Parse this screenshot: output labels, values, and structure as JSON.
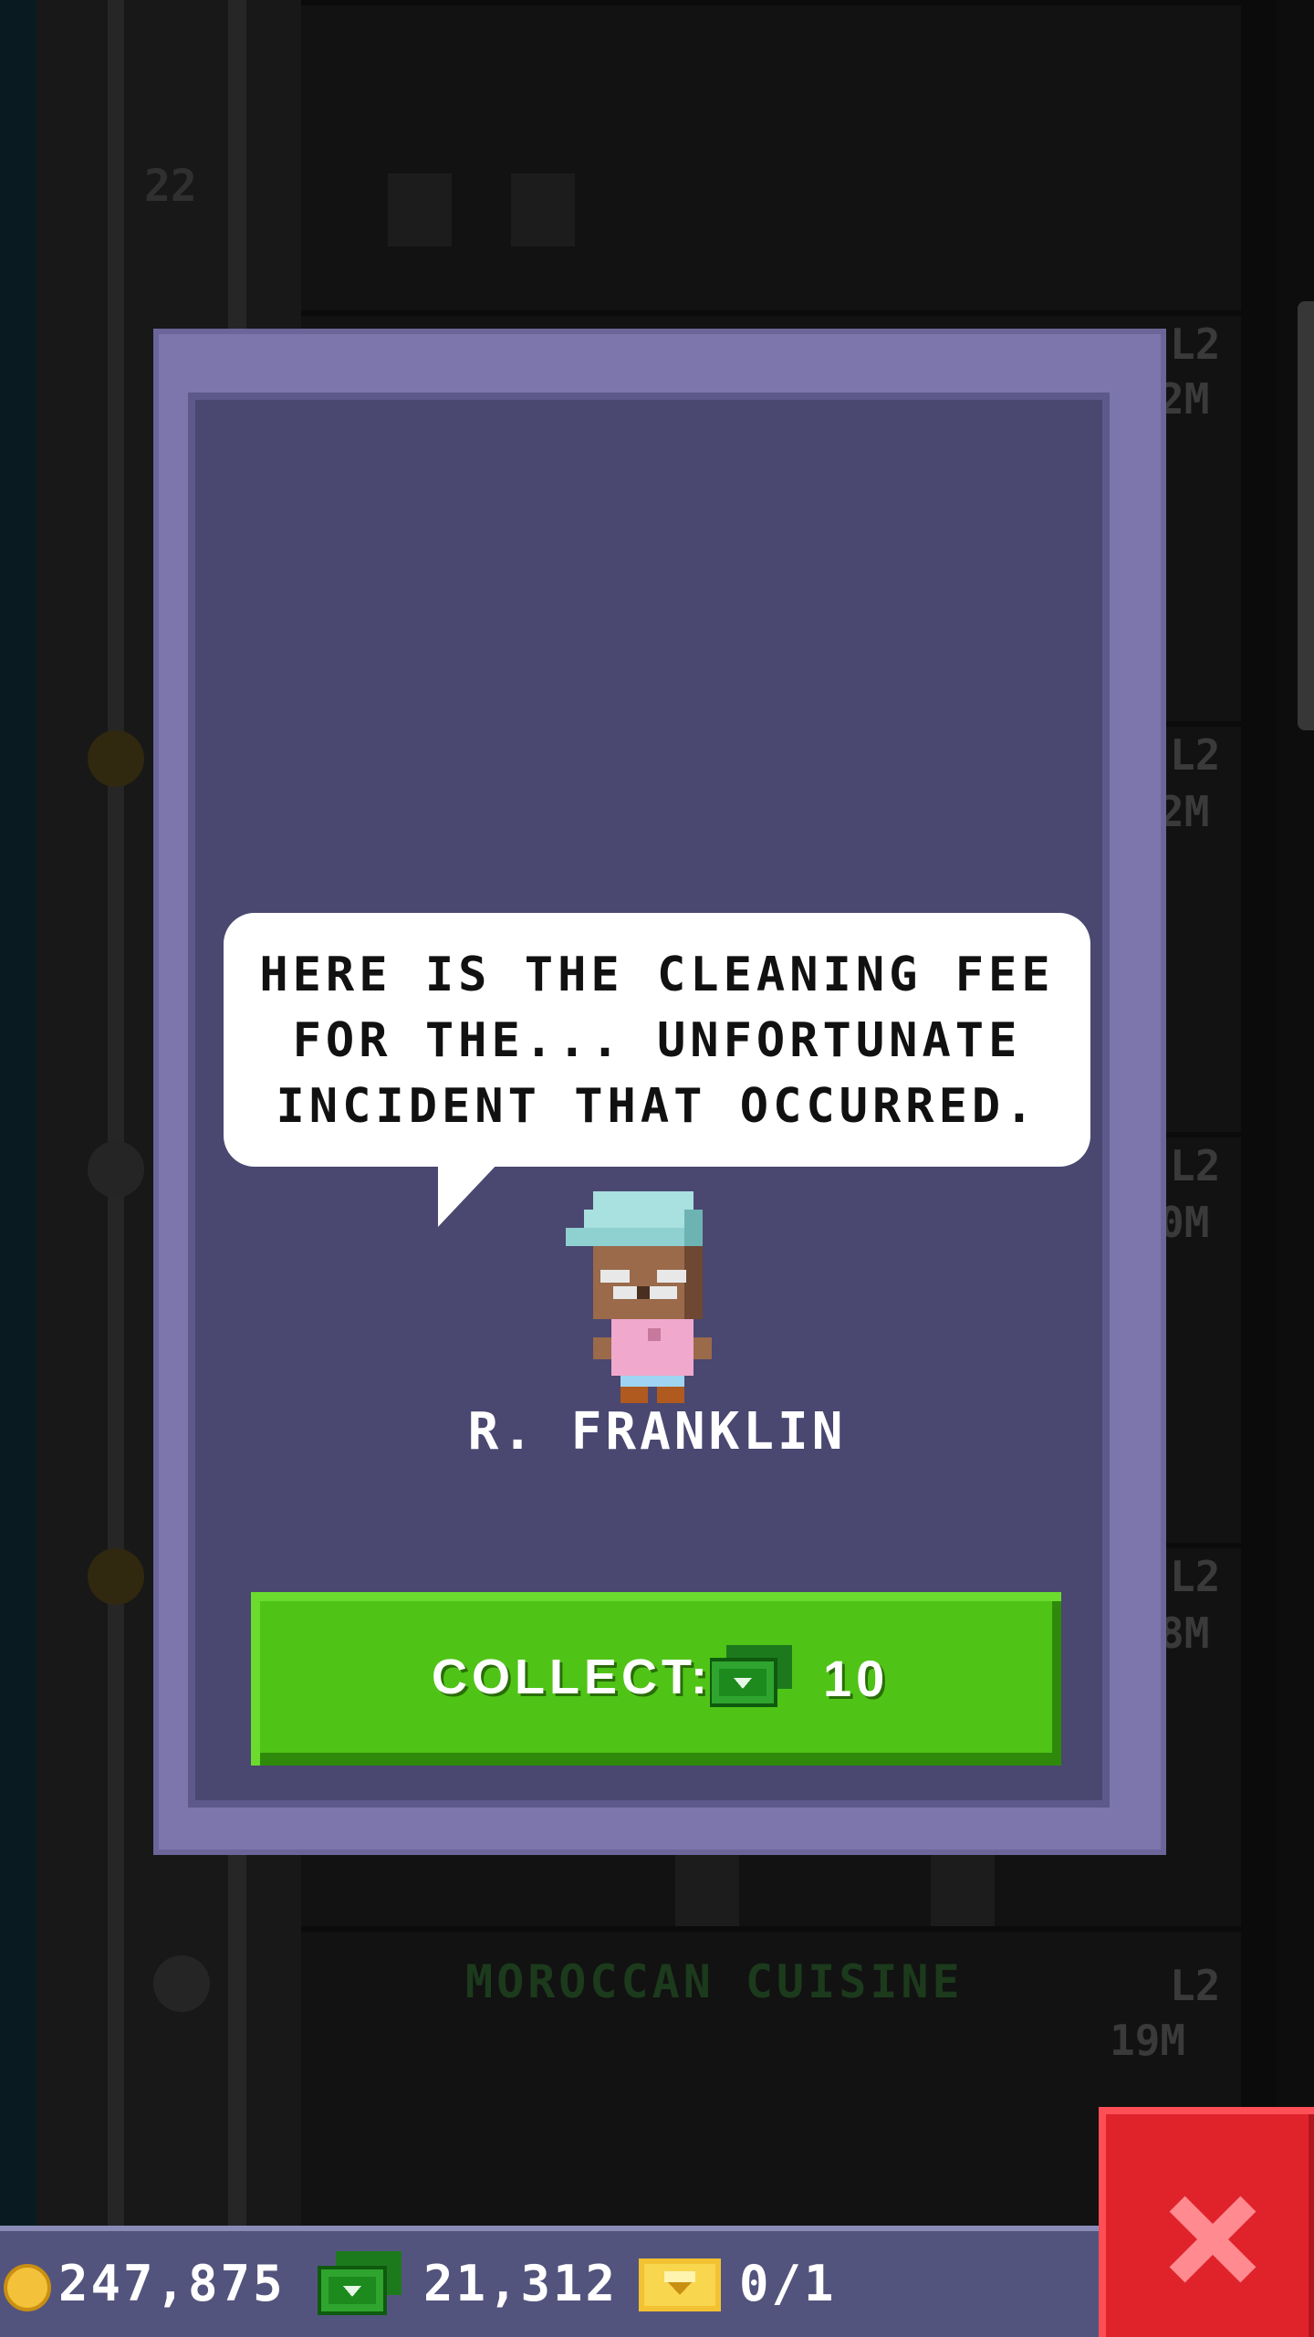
{
  "background": {
    "floor_numbers": [
      "22"
    ],
    "floor_label": "MOROCCAN CUISINE",
    "floor_levels": [
      "L2",
      "L2",
      "L2",
      "L2",
      "L2"
    ],
    "floor_times": [
      "2M",
      "2M",
      "0M",
      "8M",
      "19M"
    ]
  },
  "dialog": {
    "speech_lines": [
      "HERE IS THE CLEANING FEE",
      "FOR THE... UNFORTUNATE",
      "INCIDENT THAT OCCURRED."
    ],
    "character_name": "R. FRANKLIN",
    "collect_button": {
      "label": "COLLECT:",
      "currency_icon": "tower-bux-icon",
      "amount": "10"
    }
  },
  "bottom_bar": {
    "coins": "247,875",
    "bux": "21,312",
    "tickets": "0/1"
  },
  "colors": {
    "modal_frame": "#7c76ad",
    "modal_panel": "#4a4771",
    "collect_green": "#4fc416",
    "close_red": "#e0232b",
    "bar": "#53547d"
  }
}
